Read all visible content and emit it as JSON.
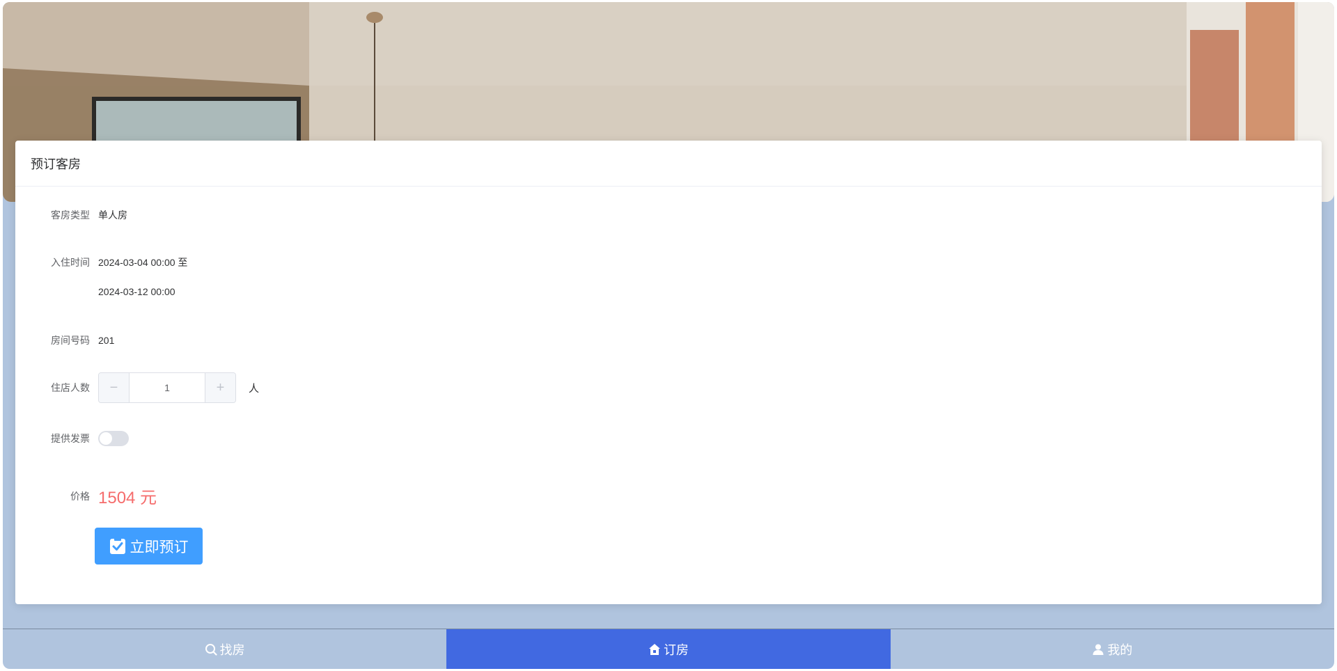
{
  "card": {
    "title": "预订客房"
  },
  "form": {
    "room_type_label": "客房类型",
    "room_type_value": "单人房",
    "checkin_label": "入住时间",
    "checkin_start": "2024-03-04 00:00 至",
    "checkin_end": "2024-03-12 00:00",
    "room_number_label": "房间号码",
    "room_number_value": "201",
    "guests_label": "住店人数",
    "guests_minus": "−",
    "guests_value": "1",
    "guests_plus": "+",
    "guests_unit": "人",
    "invoice_label": "提供发票",
    "invoice_on": false,
    "price_label": "价格",
    "price_value": "1504 元"
  },
  "book_button": {
    "label": "立即预订",
    "icon": "check-clipboard-icon"
  },
  "nav": {
    "items": [
      {
        "label": "找房",
        "icon": "search-icon",
        "active": false
      },
      {
        "label": "订房",
        "icon": "home-icon",
        "active": true
      },
      {
        "label": "我的",
        "icon": "user-icon",
        "active": false
      }
    ]
  },
  "colors": {
    "accent": "#409eff",
    "nav_active": "#4169e1",
    "background": "#b0c4de",
    "price": "#f56c6c"
  }
}
